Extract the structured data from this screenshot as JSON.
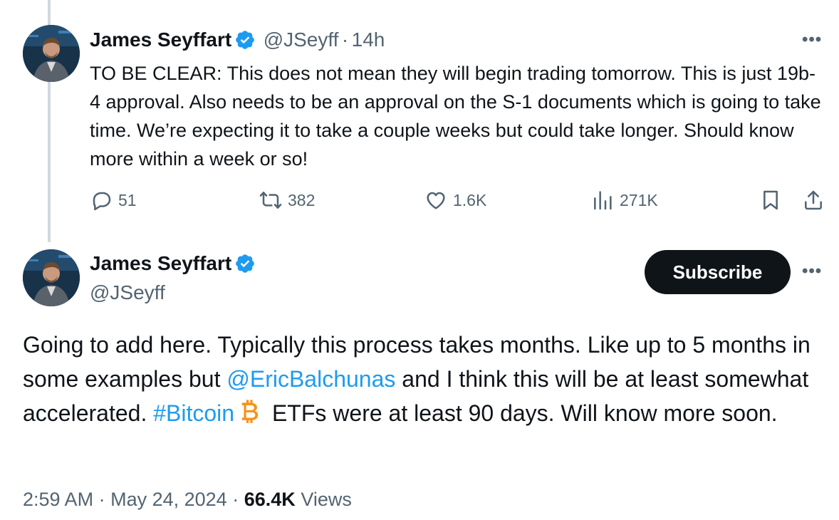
{
  "colors": {
    "accent": "#1d9bf0",
    "text": "#0f1419",
    "muted": "#536471",
    "thread_line": "#cfd9de",
    "bitcoin": "#f7931a"
  },
  "reply_tweet": {
    "author_name": "James Seyffart",
    "handle": "@JSeyff",
    "separator": "·",
    "time": "14h",
    "more_icon": "more-horizontal-icon",
    "text": "TO BE CLEAR: This does not mean they will begin trading tomorrow. This is just 19b-4 approval. Also needs to be an approval on the S-1 documents which is going to take time. We’re expecting it to take a couple weeks but could take longer. Should know more within a week or so!",
    "stats": {
      "replies": "51",
      "reposts": "382",
      "likes": "1.6K",
      "views": "271K"
    }
  },
  "main_tweet": {
    "author_name": "James Seyffart",
    "handle": "@JSeyff",
    "subscribe_label": "Subscribe",
    "text_part1": "Going to add here. Typically this process takes months. Like up to 5 months in some examples but ",
    "mention": "@EricBalchunas",
    "text_part2": " and I think this will be at least somewhat accelerated. ",
    "hashtag": "#Bitcoin",
    "emoji_icon": "bitcoin-icon",
    "text_part3": " ETFs were at least 90 days. Will know more soon.",
    "time": "2:59 AM",
    "date": "May 24, 2024",
    "views_count": "66.4K",
    "views_label": "Views"
  }
}
